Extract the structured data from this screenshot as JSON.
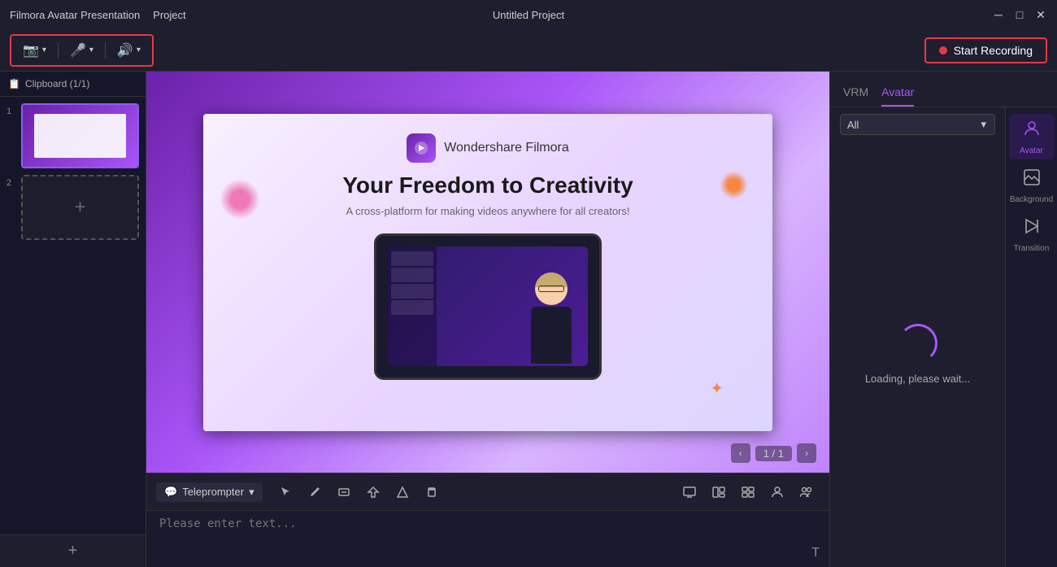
{
  "titleBar": {
    "appName": "Filmora Avatar Presentation",
    "menuItem": "Project",
    "windowTitle": "Untitled Project",
    "minimizeLabel": "─",
    "maximizeLabel": "□",
    "closeLabel": "✕"
  },
  "toolbar": {
    "cameraIcon": "📷",
    "micIcon": "🎤",
    "speakerIcon": "🔊",
    "recordLabel": "Start Recording"
  },
  "sidebar": {
    "header": "Clipboard (1/1)",
    "clipboardIcon": "📋",
    "addSlideLabel": "+",
    "slides": [
      {
        "number": "1",
        "type": "filled"
      },
      {
        "number": "2",
        "type": "empty"
      }
    ]
  },
  "canvas": {
    "slide": {
      "logoText": "Wondershare Filmora",
      "mainTitle": "Your Freedom to Creativity",
      "subTitle": "A cross-platform for making videos anywhere for all creators!",
      "pageIndicator": "1 / 1"
    }
  },
  "bottomToolbar": {
    "teleprompterLabel": "Teleprompter",
    "chevronIcon": "▼",
    "tools": [
      "↖",
      "✏",
      "⬜",
      "⬡",
      "◇",
      "🗑"
    ],
    "rightTools": [
      "▣",
      "▥",
      "▤",
      "👤",
      "👥"
    ]
  },
  "teleprompter": {
    "placeholder": "Please enter text...",
    "footerIcon": "T"
  },
  "rightPanel": {
    "tabs": [
      {
        "label": "VRM",
        "active": false
      },
      {
        "label": "Avatar",
        "active": true
      }
    ],
    "dropdownLabel": "All",
    "dropdownIcon": "▾",
    "loading": {
      "text": "Loading, please wait..."
    },
    "icons": [
      {
        "label": "Avatar",
        "icon": "👤",
        "active": true
      },
      {
        "label": "Background",
        "icon": "🖼",
        "active": false
      },
      {
        "label": "Transition",
        "icon": "⏩",
        "active": false
      }
    ]
  }
}
